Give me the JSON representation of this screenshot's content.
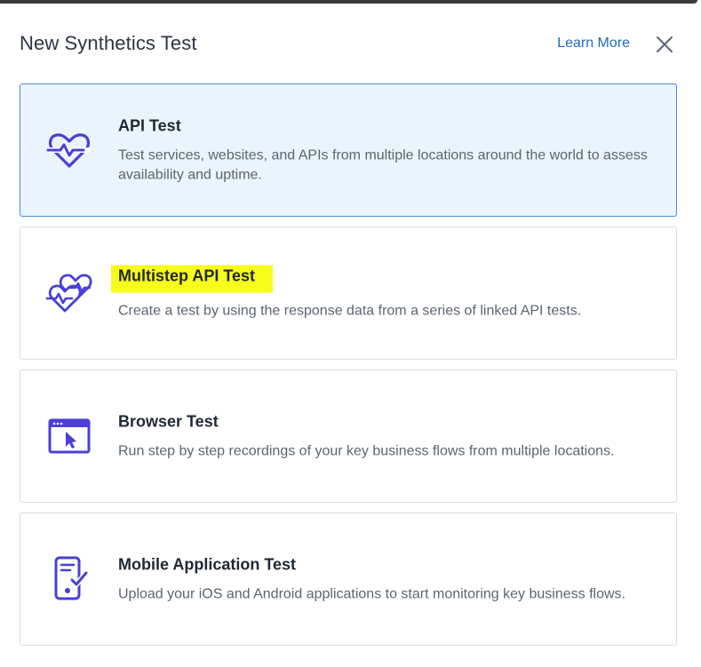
{
  "header": {
    "title": "New Synthetics Test",
    "learn_more": "Learn More",
    "close_icon": "close-icon"
  },
  "colors": {
    "accent": "#1e6ab8",
    "icon": "#4b3fd6",
    "selected_bg": "#eaf4fc",
    "selected_border": "#4a8fd4",
    "highlight": "#f8fc1b"
  },
  "cards": [
    {
      "title": "API Test",
      "description": "Test services, websites, and APIs from multiple locations around the world to assess availability and uptime.",
      "icon": "heartbeat-icon",
      "selected": true
    },
    {
      "title": "Multistep API Test",
      "description": "Create a test by using the response data from a series of linked API tests.",
      "icon": "multi-heartbeat-icon",
      "highlighted": true
    },
    {
      "title": "Browser Test",
      "description": "Run step by step recordings of your key business flows from multiple locations.",
      "icon": "browser-cursor-icon"
    },
    {
      "title": "Mobile Application Test",
      "description": "Upload your iOS and Android applications to start monitoring key business flows.",
      "icon": "mobile-check-icon"
    }
  ]
}
